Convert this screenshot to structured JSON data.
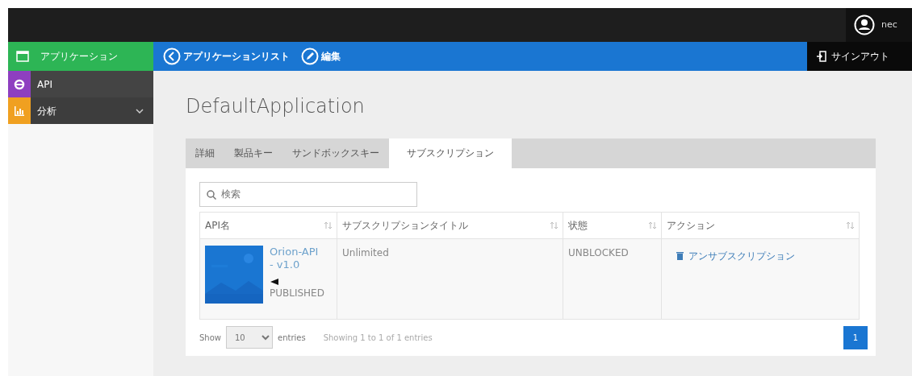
{
  "header": {
    "user": "nec"
  },
  "sidebar": {
    "title": "アプリケーション",
    "items": [
      {
        "label": "API",
        "kind": "api",
        "expandable": false
      },
      {
        "label": "分析",
        "kind": "chart",
        "expandable": true
      }
    ]
  },
  "toolbar": {
    "items": [
      {
        "label": "アプリケーションリスト",
        "kind": "back"
      },
      {
        "label": "編集",
        "kind": "edit"
      }
    ],
    "signout": "サインアウト"
  },
  "page_title": "DefaultApplication",
  "tabs": [
    {
      "label": "詳細",
      "selected": false
    },
    {
      "label": "製品キー",
      "selected": false
    },
    {
      "label": "サンドボックスキー",
      "selected": false
    },
    {
      "label": "サブスクリプション",
      "selected": true
    }
  ],
  "search": {
    "placeholder": "検索"
  },
  "table": {
    "columns": [
      "API名",
      "サブスクリプションタイトル",
      "状態",
      "アクション"
    ],
    "rows": [
      {
        "api_name": "Orion-API - v1.0",
        "api_status": "PUBLISHED",
        "subscription_title": "Unlimited",
        "state": "UNBLOCKED",
        "action": "アンサブスクリプション"
      }
    ]
  },
  "footer": {
    "show": "Show",
    "page_size": "10",
    "entries": "entries",
    "info": "Showing 1 to 1 of 1 entries",
    "pages": [
      {
        "label": "1",
        "selected": true
      }
    ]
  }
}
